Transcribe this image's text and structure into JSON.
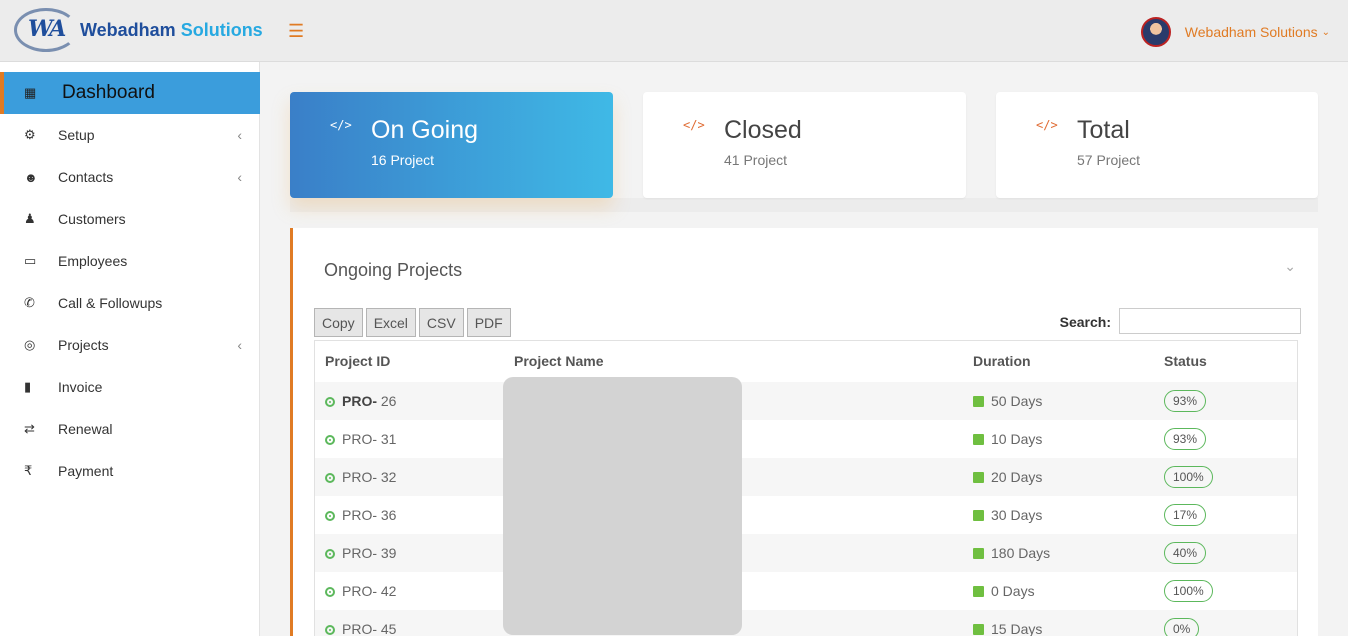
{
  "header": {
    "brand_mark": "WA",
    "brand_word1": "Webadham",
    "brand_word2": "Solutions",
    "menu_icon": "hamburger-icon",
    "user_name": "Webadham Solutions",
    "user_chevron": "chevron-down-icon"
  },
  "sidebar": {
    "items": [
      {
        "label": "Dashboard",
        "icon": "dashboard-icon",
        "arrow": ""
      },
      {
        "label": "Setup",
        "icon": "gear-icon",
        "arrow": "‹"
      },
      {
        "label": "Contacts",
        "icon": "users-icon",
        "arrow": "‹"
      },
      {
        "label": "Customers",
        "icon": "user-icon",
        "arrow": ""
      },
      {
        "label": "Employees",
        "icon": "monitor-icon",
        "arrow": ""
      },
      {
        "label": "Call & Followups",
        "icon": "phone-icon",
        "arrow": ""
      },
      {
        "label": "Projects",
        "icon": "target-icon",
        "arrow": "‹"
      },
      {
        "label": "Invoice",
        "icon": "file-icon",
        "arrow": ""
      },
      {
        "label": "Renewal",
        "icon": "retweet-icon",
        "arrow": ""
      },
      {
        "label": "Payment",
        "icon": "rupee-icon",
        "arrow": ""
      }
    ]
  },
  "cards": [
    {
      "title": "On Going",
      "sub": "16 Project",
      "icon": "code-icon"
    },
    {
      "title": "Closed",
      "sub": "41 Project",
      "icon": "code-icon"
    },
    {
      "title": "Total",
      "sub": "57 Project",
      "icon": "code-icon"
    }
  ],
  "panel": {
    "title": "Ongoing Projects",
    "buttons": [
      "Copy",
      "Excel",
      "CSV",
      "PDF"
    ],
    "search_label": "Search:",
    "search_value": ""
  },
  "table": {
    "headers": [
      "Project ID",
      "Project Name",
      "Duration",
      "Status"
    ],
    "rows": [
      {
        "id_prefix": "PRO-",
        "id_num": " 26",
        "duration": "50 Days",
        "status": "93%"
      },
      {
        "id_prefix": "PRO-",
        "id_num": " 31",
        "duration": "10 Days",
        "status": "93%"
      },
      {
        "id_prefix": "PRO-",
        "id_num": " 32",
        "duration": "20 Days",
        "status": "100%"
      },
      {
        "id_prefix": "PRO-",
        "id_num": " 36",
        "duration": "30 Days",
        "status": "17%"
      },
      {
        "id_prefix": "PRO-",
        "id_num": " 39",
        "duration": "180 Days",
        "status": "40%"
      },
      {
        "id_prefix": "PRO-",
        "id_num": " 42",
        "duration": "0 Days",
        "status": "100%"
      },
      {
        "id_prefix": "PRO-",
        "id_num": " 45",
        "duration": "15 Days",
        "status": "0%"
      }
    ]
  },
  "colors": {
    "accent": "#e07b24",
    "active_menu": "#3b9ddc",
    "ongoing_gradient_start": "#3a7fc8",
    "ongoing_gradient_end": "#3fb9e6",
    "status_green": "#5cb85c"
  }
}
